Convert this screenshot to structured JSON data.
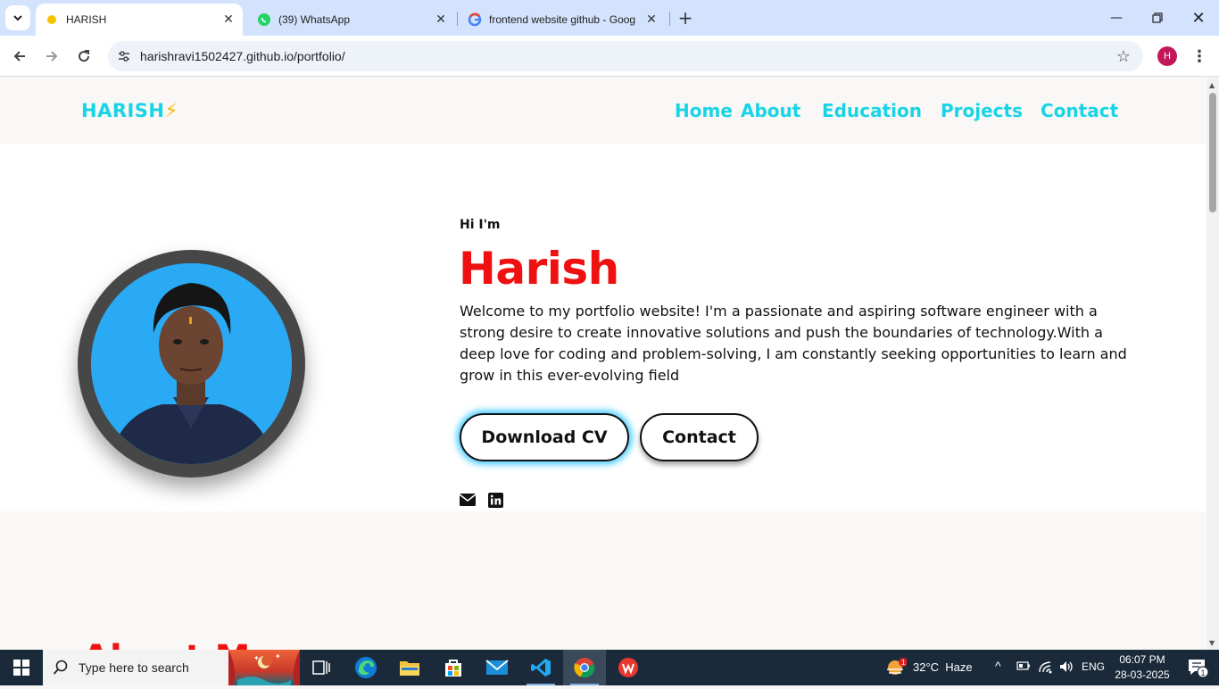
{
  "browser": {
    "tabs": [
      {
        "title": "HARISH",
        "favicon": "yellow-dot-icon",
        "active": true
      },
      {
        "title": "(39) WhatsApp",
        "favicon": "whatsapp-icon",
        "active": false
      },
      {
        "title": "frontend website github - Goog",
        "favicon": "google-icon",
        "active": false
      }
    ],
    "url": "harishravi1502427.github.io/portfolio/",
    "profile_initial": "H"
  },
  "site": {
    "logo_text": "HARISH",
    "logo_emoji": "⚡",
    "nav": [
      "Home",
      "About",
      "Education",
      "Projects",
      "Contact"
    ],
    "hero": {
      "greeting": "Hi I'm",
      "name": "Harish",
      "bio": "Welcome to my portfolio website! I'm a passionate and aspiring software engineer with a strong desire to create innovative solutions and push the boundaries of technology.With a deep love for coding and problem-solving, I am constantly seeking opportunities to learn and grow in this ever-evolving field",
      "download_cv_label": "Download CV",
      "contact_label": "Contact",
      "social_icons": [
        "envelope-icon",
        "linkedin-icon"
      ]
    },
    "next_section_heading_partial": "About M"
  },
  "colors": {
    "accent_cyan": "#19d3e6",
    "name_red": "#ef1111",
    "bolt_yellow": "#f5b800"
  },
  "taskbar": {
    "search_placeholder": "Type here to search",
    "weather": "32°C  Haze",
    "weather_badge": "1",
    "language": "ENG",
    "time": "06:07 PM",
    "date": "28-03-2025",
    "notification_count": "1"
  }
}
